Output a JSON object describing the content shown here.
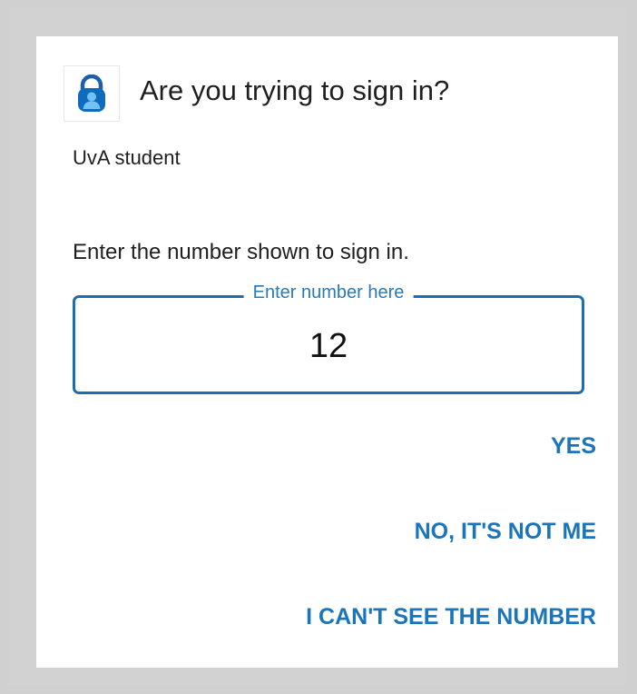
{
  "dialog": {
    "title": "Are you trying to sign in?",
    "account": "UvA student",
    "instruction": "Enter the number shown to sign in.",
    "number_input": {
      "label": "Enter number here",
      "value": "12"
    },
    "actions": {
      "yes": "YES",
      "no": "NO, IT'S NOT ME",
      "cant_see": "I CAN'T SEE THE NUMBER"
    }
  },
  "icons": {
    "app": "authenticator-lock-icon"
  },
  "colors": {
    "accent": "#1b75bb",
    "input_border": "#1a6fb4",
    "background": "#d0d0d0",
    "dialog": "#ffffff",
    "text": "#1f1f1f"
  }
}
